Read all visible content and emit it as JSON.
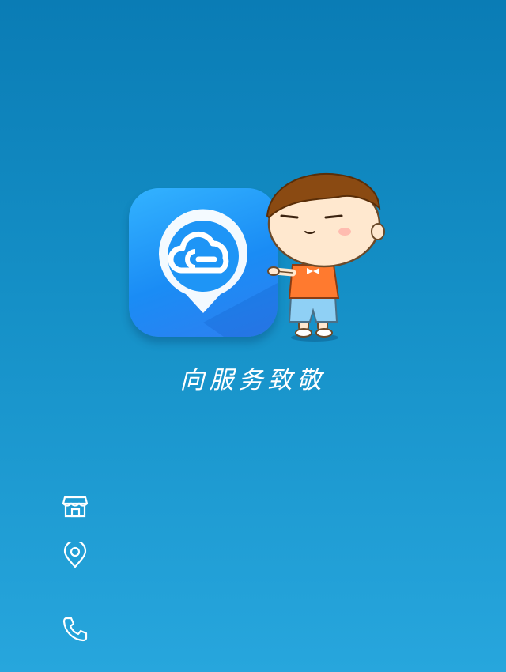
{
  "app": {
    "slogan": "向服务致敬",
    "icon_name": "cloud-wrench-pin-icon",
    "mascot_name": "cartoon-boy-mascot"
  },
  "contact": {
    "store_icon": "store-icon",
    "store_name": "",
    "location_icon": "location-pin-icon",
    "address": "",
    "phone_icon": "phone-icon",
    "phone": ""
  },
  "colors": {
    "background_top": "#0a7cb5",
    "background_bottom": "#27a6dd",
    "app_icon": "#1a8cf5",
    "text": "#ffffff"
  }
}
